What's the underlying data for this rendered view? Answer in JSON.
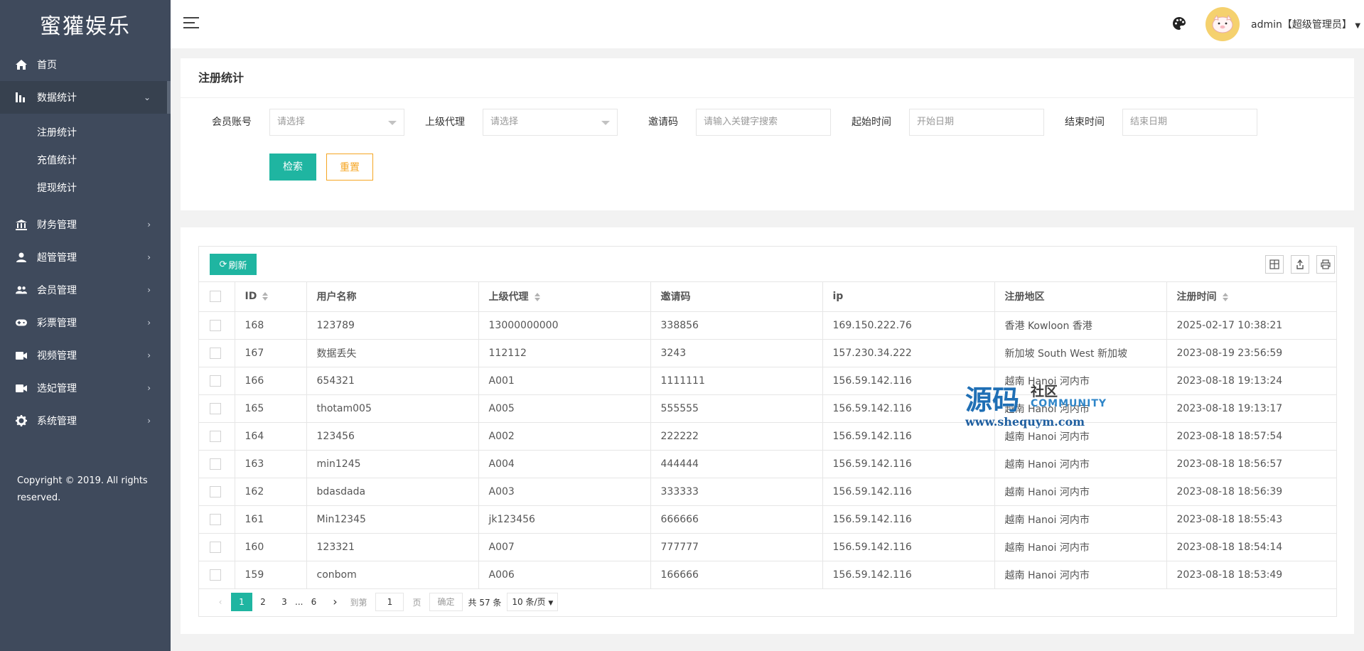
{
  "brand": "蜜獾娱乐",
  "sidebar": {
    "items": [
      {
        "label": "首页",
        "icon": "home-icon",
        "has_arrow": false
      },
      {
        "label": "数据统计",
        "icon": "bar-chart-icon",
        "has_arrow": true,
        "active": true,
        "children": [
          "注册统计",
          "充值统计",
          "提现统计"
        ]
      },
      {
        "label": "财务管理",
        "icon": "bank-icon",
        "has_arrow": true
      },
      {
        "label": "超管管理",
        "icon": "user-icon",
        "has_arrow": true
      },
      {
        "label": "会员管理",
        "icon": "users-icon",
        "has_arrow": true
      },
      {
        "label": "彩票管理",
        "icon": "gamepad-icon",
        "has_arrow": true
      },
      {
        "label": "视频管理",
        "icon": "video-icon",
        "has_arrow": true
      },
      {
        "label": "选妃管理",
        "icon": "video-camera-icon",
        "has_arrow": true
      },
      {
        "label": "系统管理",
        "icon": "gear-icon",
        "has_arrow": true
      }
    ],
    "copyright": "Copyright © 2019. All rights reserved."
  },
  "header": {
    "user": "admin【超级管理员】"
  },
  "search": {
    "title": "注册统计",
    "fields": [
      {
        "label": "会员账号",
        "placeholder": "请选择",
        "type": "select"
      },
      {
        "label": "上级代理",
        "placeholder": "请选择",
        "type": "select"
      },
      {
        "label": "邀请码",
        "placeholder": "请输入关键字搜索",
        "type": "input"
      },
      {
        "label": "起始时间",
        "placeholder": "开始日期",
        "type": "date"
      },
      {
        "label": "结束时间",
        "placeholder": "结束日期",
        "type": "date"
      }
    ],
    "search_label": "检索",
    "reset_label": "重置"
  },
  "table": {
    "refresh_label": "刷新",
    "columns": [
      "ID",
      "用户名称",
      "上级代理",
      "邀请码",
      "ip",
      "注册地区",
      "注册时间"
    ],
    "sortable": [
      true,
      false,
      true,
      false,
      false,
      false,
      true
    ],
    "rows": [
      [
        "168",
        "123789",
        "13000000000",
        "338856",
        "169.150.222.76",
        "香港 Kowloon 香港",
        "2025-02-17 10:38:21"
      ],
      [
        "167",
        "数据丢失",
        "112112",
        "3243",
        "157.230.34.222",
        "新加坡 South West 新加坡",
        "2023-08-19 23:56:59"
      ],
      [
        "166",
        "654321",
        "A001",
        "1111111",
        "156.59.142.116",
        "越南 Hanoi 河内市",
        "2023-08-18 19:13:24"
      ],
      [
        "165",
        "thotam005",
        "A005",
        "555555",
        "156.59.142.116",
        "越南 Hanoi 河内市",
        "2023-08-18 19:13:17"
      ],
      [
        "164",
        "123456",
        "A002",
        "222222",
        "156.59.142.116",
        "越南 Hanoi 河内市",
        "2023-08-18 18:57:54"
      ],
      [
        "163",
        "min1245",
        "A004",
        "444444",
        "156.59.142.116",
        "越南 Hanoi 河内市",
        "2023-08-18 18:56:57"
      ],
      [
        "162",
        "bdasdada",
        "A003",
        "333333",
        "156.59.142.116",
        "越南 Hanoi 河内市",
        "2023-08-18 18:56:39"
      ],
      [
        "161",
        "Min12345",
        "jk123456",
        "666666",
        "156.59.142.116",
        "越南 Hanoi 河内市",
        "2023-08-18 18:55:43"
      ],
      [
        "160",
        "123321",
        "A007",
        "777777",
        "156.59.142.116",
        "越南 Hanoi 河内市",
        "2023-08-18 18:54:14"
      ],
      [
        "159",
        "conbom",
        "A006",
        "166666",
        "156.59.142.116",
        "越南 Hanoi 河内市",
        "2023-08-18 18:53:49"
      ]
    ]
  },
  "pager": {
    "pages": [
      "1",
      "2",
      "3",
      "6"
    ],
    "ellipsis": "...",
    "current": "1",
    "goto_label": "到第",
    "goto_value": "1",
    "page_unit": "页",
    "confirm_label": "确定",
    "total_label": "共 57 条",
    "page_size": "10 条/页"
  },
  "watermark": {
    "big": "源码",
    "small": "社区",
    "community": "COMMUNITY",
    "url": "www.shequym.com"
  },
  "colors": {
    "sidebar_bg": "#3f4a5c",
    "accent": "#1fb5a1",
    "reset": "#f5a623"
  }
}
